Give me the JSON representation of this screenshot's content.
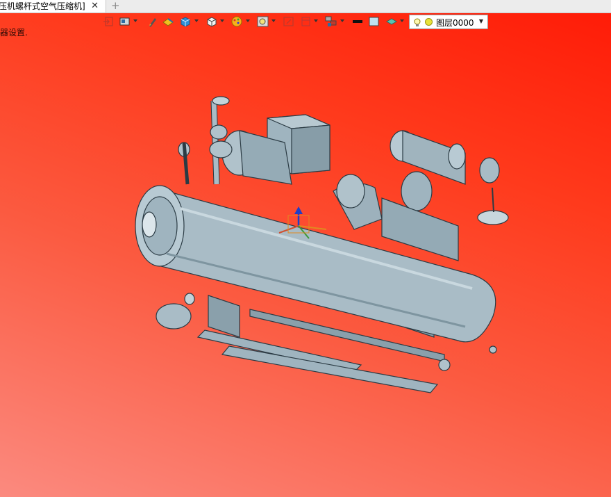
{
  "tab": {
    "title": "压机螺杆式空气压缩机]",
    "close_glyph": "✕"
  },
  "new_tab_glyph": "+",
  "status_text": "器设置.",
  "toolbar": {
    "items": [
      "exit-sketch-icon",
      "view-mode-icon",
      "pen-icon",
      "paint-icon",
      "solid-box-icon",
      "box-view-icon",
      "palette-icon",
      "zoom-icon",
      "section-icon",
      "frame-icon",
      "layers-icon",
      "line-color-icon",
      "fill-color-icon",
      "material-icon"
    ]
  },
  "layer": {
    "name": "图层0000",
    "dropdown_glyph": "▼",
    "indicator_color": "#e8e23a"
  },
  "model": {
    "color": "#9fb4bf"
  }
}
